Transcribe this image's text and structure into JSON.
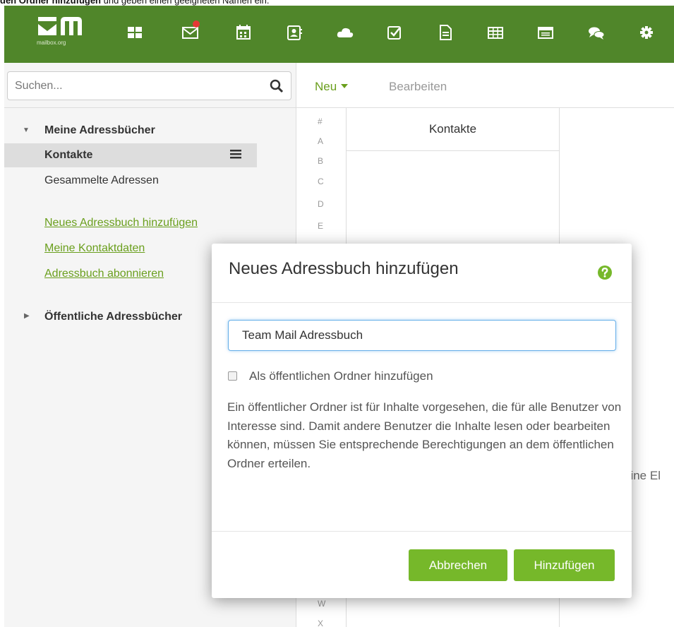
{
  "caption": {
    "bold": "den Ordner hinzufügen",
    "rest": " und geben einen geeigneten Namen ein."
  },
  "app": {
    "logo_text": "mailbox.org"
  },
  "colors": {
    "topbar": "#50862a",
    "accent": "#76b82a",
    "link": "#6a9f1d",
    "notification": "#e53935"
  },
  "nav_icons": [
    "portal-icon",
    "mail-icon",
    "calendar-icon",
    "contacts-icon",
    "drive-icon",
    "tasks-icon",
    "documents-icon",
    "spreadsheet-icon",
    "presentation-icon",
    "chat-icon",
    "settings-icon"
  ],
  "search": {
    "placeholder": "Suchen..."
  },
  "sidebar": {
    "my_books_header": "Meine Adressbücher",
    "items": [
      {
        "label": "Kontakte",
        "selected": true
      },
      {
        "label": "Gesammelte Adressen",
        "selected": false
      }
    ],
    "links": [
      "Neues Adressbuch hinzufügen",
      "Meine Kontaktdaten",
      "Adressbuch abonnieren"
    ],
    "public_books_header": "Öffentliche Adressbücher"
  },
  "toolbar": {
    "new_label": "Neu",
    "edit_label": "Bearbeiten"
  },
  "letters": [
    "#",
    "A",
    "B",
    "C",
    "D",
    "E"
  ],
  "letters_bottom": [
    "W",
    "X"
  ],
  "list": {
    "header": "Kontakte"
  },
  "detail": {
    "empty_text": "eine El"
  },
  "dialog": {
    "title": "Neues Adressbuch hinzufügen",
    "name_value": "Team Mail Adressbuch",
    "public_checkbox_label": "Als öffentlichen Ordner hinzufügen",
    "public_checkbox_checked": false,
    "description": "Ein öffentlicher Ordner ist für Inhalte vorgesehen, die für alle Benutzer von Interesse sind. Damit andere Benutzer die Inhalte lesen oder bearbeiten können, müssen Sie entsprechende Berechtigungen an dem öffentlichen Ordner erteilen.",
    "cancel_label": "Abbrechen",
    "submit_label": "Hinzufügen"
  }
}
